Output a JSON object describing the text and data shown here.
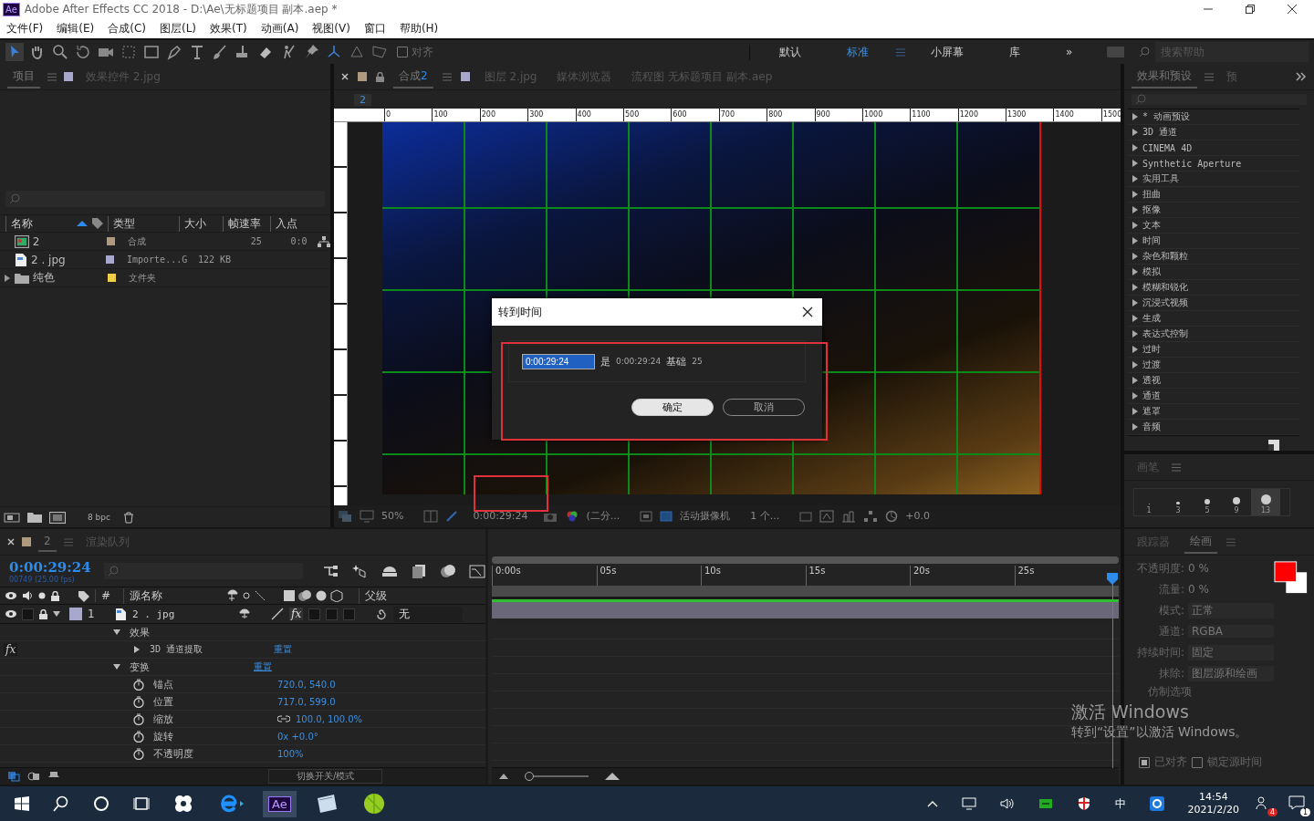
{
  "title_bar": {
    "app_icon": "Ae",
    "title": "Adobe After Effects CC 2018 - D:\\Ae\\无标题项目 副本.aep *"
  },
  "menu": [
    "文件(F)",
    "编辑(E)",
    "合成(C)",
    "图层(L)",
    "效果(T)",
    "动画(A)",
    "视图(V)",
    "窗口",
    "帮助(H)"
  ],
  "toolbar": {
    "snap": {
      "label": "对齐",
      "checked": false
    },
    "workspaces": [
      {
        "label": "默认",
        "selected": false
      },
      {
        "label": "标准",
        "selected": true
      },
      {
        "label": "小屏幕",
        "selected": false
      },
      {
        "label": "库",
        "selected": false
      }
    ],
    "overflow": "»",
    "search_placeholder": "搜索帮助"
  },
  "project_panel": {
    "tabs": [
      {
        "label": "项目",
        "selected": true
      },
      {
        "label": "效果控件 2.jpg",
        "selected": false
      }
    ],
    "columns": [
      "名称",
      "类型",
      "大小",
      "帧速率",
      "入点"
    ],
    "rows": [
      {
        "kind": "comp",
        "name": "2",
        "type": "合成",
        "size": "",
        "fps": "25",
        "in_point": "0:0",
        "color": "#b09a7e"
      },
      {
        "kind": "image",
        "name": "2 . jpg",
        "type": "Importe...G",
        "size": "122 KB",
        "fps": "",
        "in_point": "",
        "color": "#a8a8cc"
      },
      {
        "kind": "folder",
        "name": "纯色",
        "type": "文件夹",
        "size": "",
        "fps": "",
        "in_point": "",
        "color": "#f0cf48",
        "expanded": false
      }
    ],
    "bpc": "8 bpc"
  },
  "composition_panel": {
    "tabs": [
      {
        "label": "合成",
        "number": "2",
        "selected": true
      },
      {
        "label": "图层 2.jpg",
        "selected": false
      },
      {
        "label": "媒体浏览器",
        "selected": false
      },
      {
        "label": "流程图 无标题项目 副本.aep",
        "selected": false
      }
    ],
    "breadcrumb": "2",
    "ruler": [
      "0",
      "100",
      "200",
      "300",
      "400",
      "500",
      "600",
      "700",
      "800",
      "900",
      "1000",
      "1100",
      "1200",
      "1300",
      "1400",
      "1500"
    ],
    "footer": {
      "zoom": "50%",
      "timecode": "0:00:29:24",
      "resolution": "(二分...",
      "camera": "活动摄像机",
      "views": "1 个...",
      "exposure": "+0.0"
    }
  },
  "dialog": {
    "title": "转到时间",
    "value": "0:00:29:24",
    "is_label": "是",
    "is_value": "0:00:29:24",
    "base_label": "基础",
    "base_value": "25",
    "buttons": [
      {
        "label": "确定",
        "kind": "primary"
      },
      {
        "label": "取消",
        "kind": "secondary"
      }
    ]
  },
  "effects_panel": {
    "tabs": [
      {
        "label": "效果和预设",
        "selected": true
      },
      {
        "label": "预",
        "selected": false
      }
    ],
    "items": [
      {
        "label": "* 动画预设",
        "expanded": false
      },
      {
        "label": "3D 通道",
        "expanded": false
      },
      {
        "label": "CINEMA 4D",
        "expanded": false
      },
      {
        "label": "Synthetic Aperture",
        "expanded": false
      },
      {
        "label": "实用工具",
        "expanded": false
      },
      {
        "label": "扭曲",
        "expanded": false
      },
      {
        "label": "抠像",
        "expanded": false
      },
      {
        "label": "文本",
        "expanded": false
      },
      {
        "label": "时间",
        "expanded": false
      },
      {
        "label": "杂色和颗粒",
        "expanded": false
      },
      {
        "label": "模拟",
        "expanded": false
      },
      {
        "label": "模糊和锐化",
        "expanded": false
      },
      {
        "label": "沉浸式视频",
        "expanded": false
      },
      {
        "label": "生成",
        "expanded": false
      },
      {
        "label": "表达式控制",
        "expanded": false
      },
      {
        "label": "过时",
        "expanded": false
      },
      {
        "label": "过渡",
        "expanded": false
      },
      {
        "label": "透视",
        "expanded": false
      },
      {
        "label": "通道",
        "expanded": false
      },
      {
        "label": "遮罩",
        "expanded": false
      },
      {
        "label": "音频",
        "expanded": false
      }
    ]
  },
  "brush_panel": {
    "title": "画笔",
    "sizes": [
      "1",
      "3",
      "5",
      "9",
      "13"
    ]
  },
  "timeline": {
    "tabs": [
      {
        "label": "2",
        "selected": true
      },
      {
        "label": "渲染队列",
        "selected": false
      }
    ],
    "timecode": "0:00:29:24",
    "frames": "00749 (25.00 fps)",
    "columns": [
      "#",
      "源名称",
      "父级"
    ],
    "ruler": [
      "0:00s",
      "05s",
      "10s",
      "15s",
      "20s",
      "25s"
    ],
    "layer": {
      "number": "1",
      "name": "2 . jpg",
      "parent": "无",
      "visible": true,
      "expanded": true,
      "color": "#a8a8cc",
      "fx_switch": {
        "label": "fx",
        "on": true
      },
      "children": [
        {
          "name": "效果",
          "expanded": true,
          "children": [
            {
              "name": "3D 通道提取",
              "expanded": false,
              "fx_label": "fx",
              "value": "重置"
            }
          ]
        },
        {
          "name": "变换",
          "expanded": true,
          "value": "重置",
          "children": [
            {
              "name": "锚点",
              "value": "720.0, 540.0"
            },
            {
              "name": "位置",
              "value": "717.0, 599.0"
            },
            {
              "name": "缩放",
              "value": "100.0, 100.0%",
              "linked": true
            },
            {
              "name": "旋转",
              "value": "0x +0.0°"
            },
            {
              "name": "不透明度",
              "value": "100%"
            }
          ]
        }
      ]
    },
    "footer": "切换开关/模式",
    "zoom": {
      "level": 0
    }
  },
  "paint_panel": {
    "tabs": [
      {
        "label": "跟踪器",
        "selected": false
      },
      {
        "label": "绘画",
        "selected": true
      }
    ],
    "fields": [
      {
        "label": "不透明度:",
        "value": "0 %"
      },
      {
        "label": "流量:",
        "value": "0 %"
      },
      {
        "label": "模式:",
        "value": "正常"
      },
      {
        "label": "通道:",
        "value": "RGBA"
      },
      {
        "label": "持续时间:",
        "value": "固定"
      },
      {
        "label": "抹除:",
        "value": "图层源和绘画"
      }
    ],
    "clone_label": "仿制选项",
    "aligned": {
      "label": "已对齐",
      "checked": true
    },
    "lock_time": {
      "label": "锁定源时间",
      "checked": false
    }
  },
  "activation": {
    "title": "激活 Windows",
    "text": "转到“设置”以激活 Windows。"
  },
  "taskbar": {
    "app_label": "Ae",
    "ime": "中",
    "time": "14:54",
    "date": "2021/2/20",
    "badge": "4",
    "notifications": "1"
  }
}
